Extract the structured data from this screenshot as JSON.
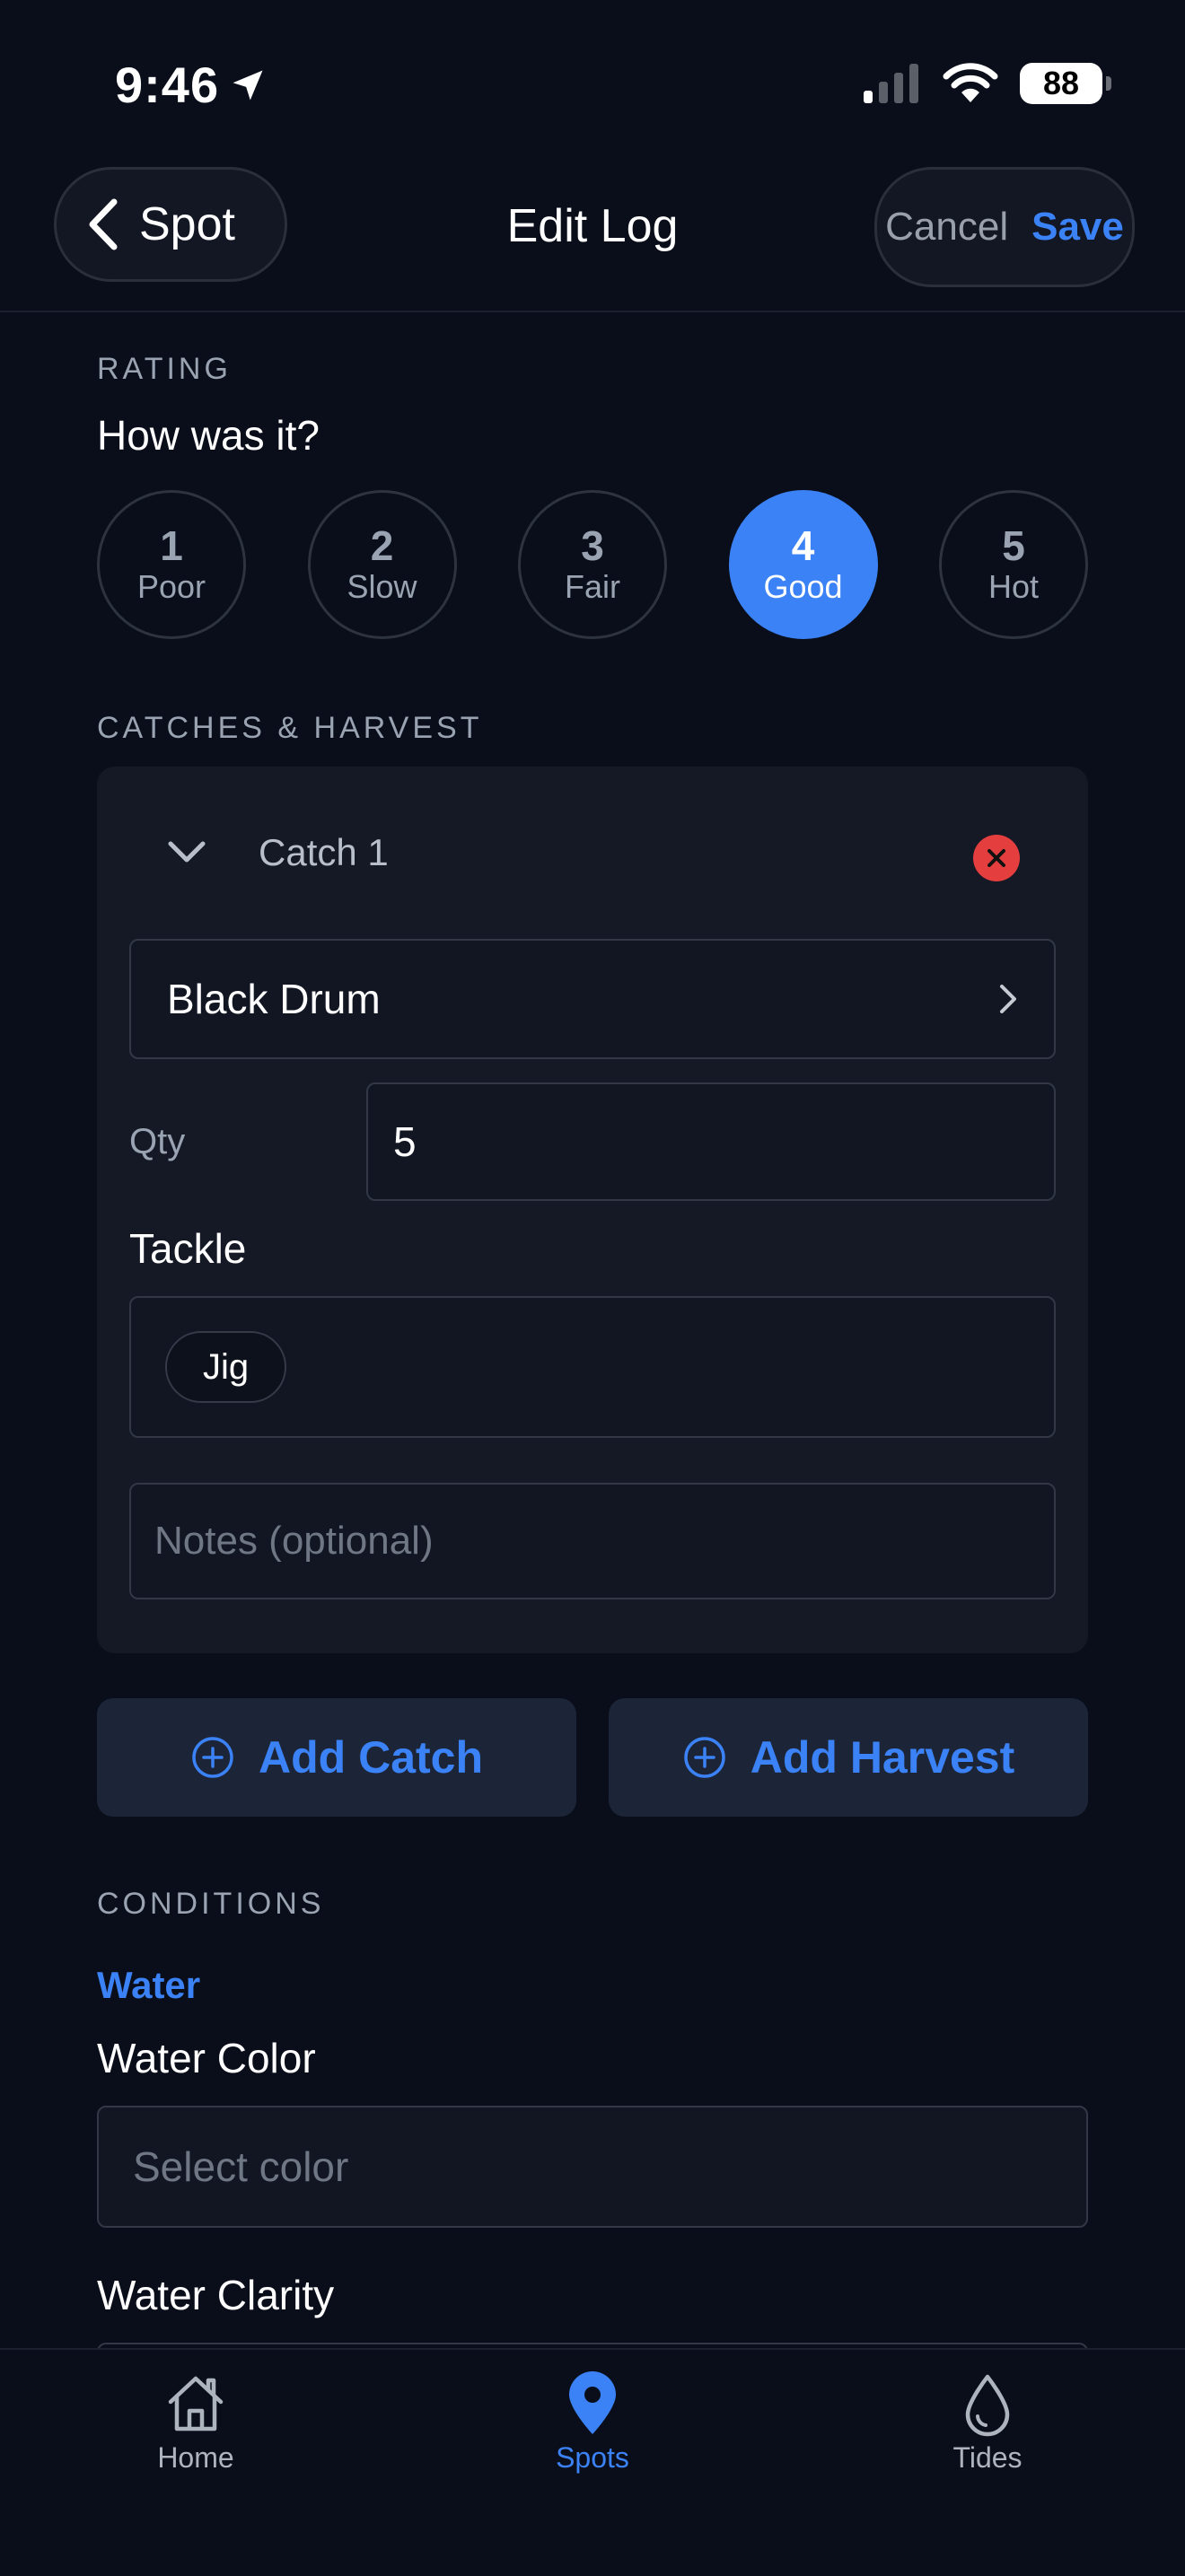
{
  "status_bar": {
    "time": "9:46",
    "battery": "88"
  },
  "nav": {
    "back_label": "Spot",
    "title": "Edit Log",
    "cancel": "Cancel",
    "save": "Save"
  },
  "rating": {
    "section": "RATING",
    "question": "How was it?",
    "options": [
      {
        "number": "1",
        "label": "Poor"
      },
      {
        "number": "2",
        "label": "Slow"
      },
      {
        "number": "3",
        "label": "Fair"
      },
      {
        "number": "4",
        "label": "Good"
      },
      {
        "number": "5",
        "label": "Hot"
      }
    ],
    "selected": "4"
  },
  "catches": {
    "section": "CATCHES & HARVEST",
    "items": [
      {
        "title": "Catch 1",
        "species": "Black Drum",
        "qty_label": "Qty",
        "qty": "5",
        "tackle_label": "Tackle",
        "tackle": [
          "Jig"
        ],
        "notes_placeholder": "Notes (optional)"
      }
    ],
    "add_catch": "Add Catch",
    "add_harvest": "Add Harvest"
  },
  "conditions": {
    "section": "CONDITIONS",
    "water_heading": "Water",
    "water_color_label": "Water Color",
    "water_color_placeholder": "Select color",
    "water_clarity_label": "Water Clarity"
  },
  "tabs": [
    {
      "label": "Home",
      "icon": "house-icon"
    },
    {
      "label": "Spots",
      "icon": "map-pin-icon",
      "active": true
    },
    {
      "label": "Tides",
      "icon": "water-drop-icon"
    }
  ],
  "colors": {
    "accent": "#3b82f6",
    "background": "#0a0e1a",
    "danger": "#e53e3e"
  }
}
